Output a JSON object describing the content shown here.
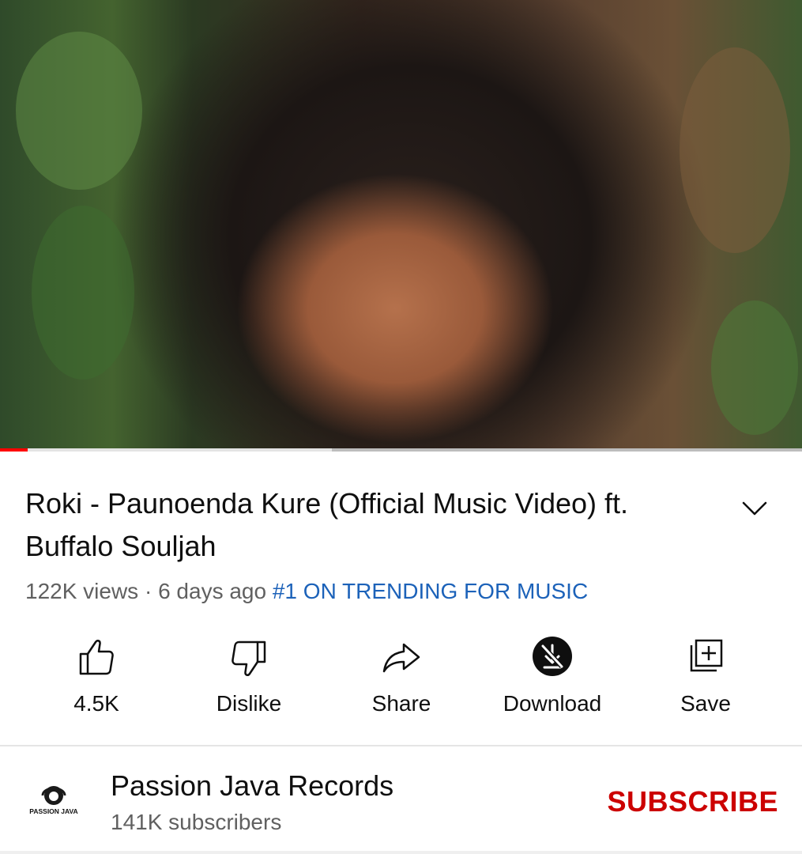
{
  "video": {
    "progress_played": 0.034,
    "progress_buffered": 0.414
  },
  "title": "Roki - Paunoenda Kure (Official Music Video) ft. Buffalo Souljah",
  "meta": {
    "views": "122K views",
    "separator": " · ",
    "age": "6 days ago",
    "trending": "#1 ON TRENDING FOR MUSIC"
  },
  "actions": {
    "like": "4.5K",
    "dislike": "Dislike",
    "share": "Share",
    "download": "Download",
    "save": "Save"
  },
  "channel": {
    "name": "Passion Java Records",
    "subscribers": "141K subscribers",
    "logo_text": "PASSION JAVA",
    "subscribe": "SUBSCRIBE"
  },
  "icons": {
    "expand": "chevron-down-icon",
    "like": "thumbs-up-icon",
    "dislike": "thumbs-down-icon",
    "share": "share-arrow-icon",
    "download": "download-disabled-icon",
    "save": "playlist-add-icon"
  },
  "colors": {
    "accent_red": "#ff0000",
    "subscribe_red": "#cc0000",
    "trending_blue": "#1c62b9",
    "secondary_text": "#606060"
  }
}
